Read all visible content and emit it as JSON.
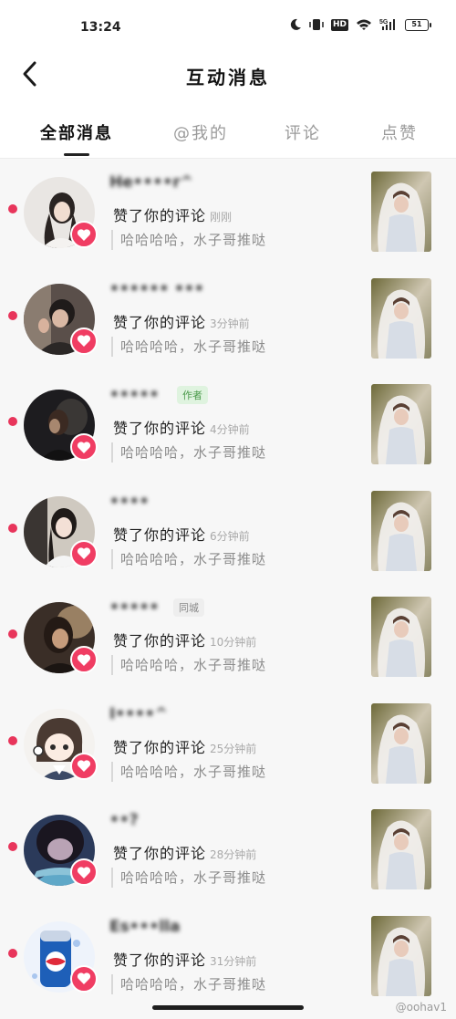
{
  "status_bar": {
    "time": "13:24",
    "network": "5G",
    "hd_label": "HD",
    "battery": "51"
  },
  "header": {
    "title": "互动消息",
    "back_icon": "chevron-left-icon"
  },
  "tabs": [
    {
      "label": "全部消息",
      "active": true
    },
    {
      "label": "@我的",
      "active": false
    },
    {
      "label": "评论",
      "active": false
    },
    {
      "label": "点赞",
      "active": false
    }
  ],
  "messages": [
    {
      "name": "He••••r^",
      "tag": "",
      "action": "赞了你的评论",
      "time": "刚刚",
      "comment": "哈哈哈哈，水子哥推哒"
    },
    {
      "name": "•••••• •••",
      "tag": "",
      "action": "赞了你的评论",
      "time": "3分钟前",
      "comment": "哈哈哈哈，水子哥推哒"
    },
    {
      "name": "•••••",
      "tag": "作者",
      "action": "赞了你的评论",
      "time": "4分钟前",
      "comment": "哈哈哈哈，水子哥推哒"
    },
    {
      "name": "••••",
      "tag": "",
      "action": "赞了你的评论",
      "time": "6分钟前",
      "comment": "哈哈哈哈，水子哥推哒"
    },
    {
      "name": "•••••",
      "tag": "同城",
      "action": "赞了你的评论",
      "time": "10分钟前",
      "comment": "哈哈哈哈，水子哥推哒"
    },
    {
      "name": "I••••^",
      "tag": "",
      "action": "赞了你的评论",
      "time": "25分钟前",
      "comment": "哈哈哈哈，水子哥推哒"
    },
    {
      "name": "••?",
      "tag": "",
      "action": "赞了你的评论",
      "time": "28分钟前",
      "comment": "哈哈哈哈，水子哥推哒"
    },
    {
      "name": "Es•••lla",
      "tag": "",
      "action": "赞了你的评论",
      "time": "31分钟前",
      "comment": "哈哈哈哈，水子哥推哒"
    }
  ],
  "watermark": "@oohav1",
  "colors": {
    "accent": "#f03d63",
    "unread_dot": "#e8355b"
  }
}
